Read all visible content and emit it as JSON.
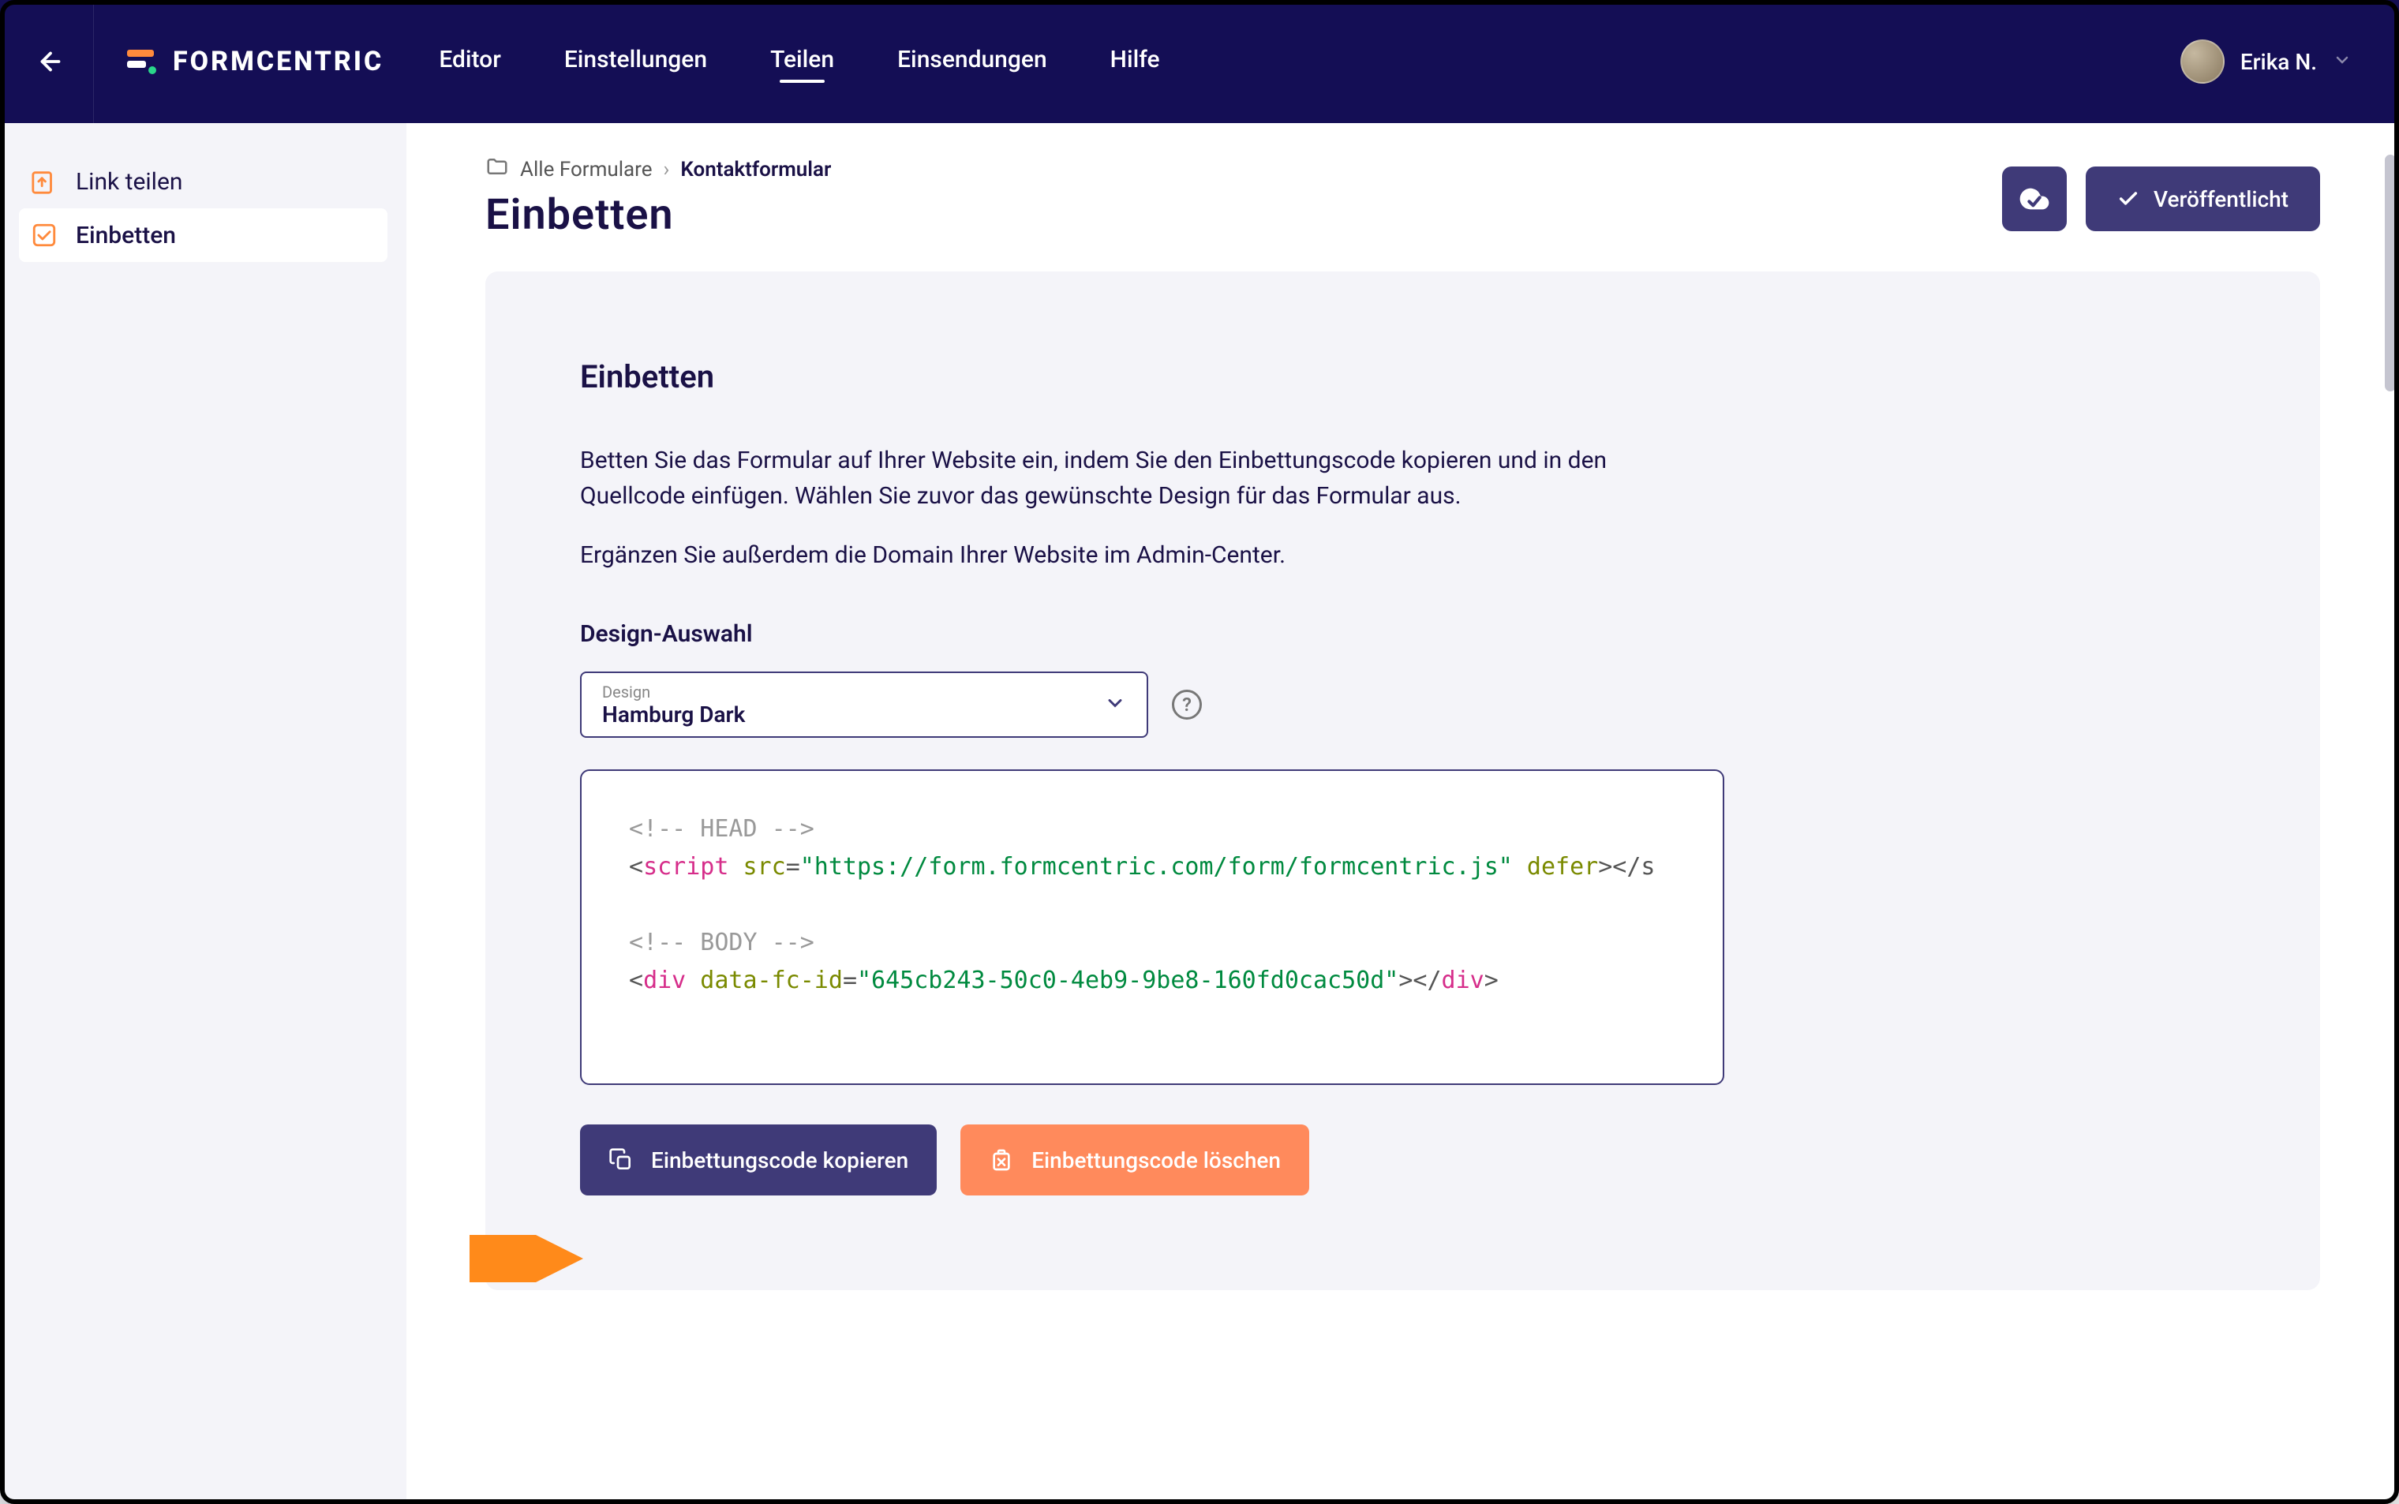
{
  "header": {
    "brand": "FORMCENTRIC",
    "nav": {
      "editor": "Editor",
      "settings": "Einstellungen",
      "share": "Teilen",
      "submissions": "Einsendungen",
      "help": "Hilfe"
    },
    "user_name": "Erika N."
  },
  "sidebar": {
    "share_link": "Link teilen",
    "embed": "Einbetten"
  },
  "breadcrumb": {
    "root": "Alle Formulare",
    "current": "Kontaktformular"
  },
  "page": {
    "title": "Einbetten",
    "publish_label": "Veröffentlicht"
  },
  "card": {
    "heading": "Einbetten",
    "para1": "Betten Sie das Formular auf Ihrer Website ein, indem Sie den Einbettungscode kopieren und in den Quellcode einfügen. Wählen Sie zuvor das gewünschte Design für das Formular aus.",
    "para2": "Ergänzen Sie außerdem die Domain Ihrer Website im Admin-Center.",
    "design_section": "Design-Auswahl",
    "select_label": "Design",
    "select_value": "Hamburg Dark"
  },
  "code": {
    "head_comment": "<!-- HEAD -->",
    "script_open_lt": "<",
    "script_tag": "script",
    "src_attr": " src",
    "eq": "=",
    "src_val": "\"https://form.formcentric.com/form/formcentric.js\"",
    "defer_attr": " defer",
    "gt": ">",
    "script_close": "</s",
    "body_comment": "<!-- BODY -->",
    "div_tag": "div",
    "fc_attr": " data-fc-id",
    "fc_val": "\"645cb243-50c0-4eb9-9be8-160fd0cac50d\"",
    "div_close_open": "></",
    "div_close_gt": ">"
  },
  "buttons": {
    "copy": "Einbettungscode kopieren",
    "delete": "Einbettungscode löschen"
  },
  "icons": {
    "help_q": "?"
  }
}
